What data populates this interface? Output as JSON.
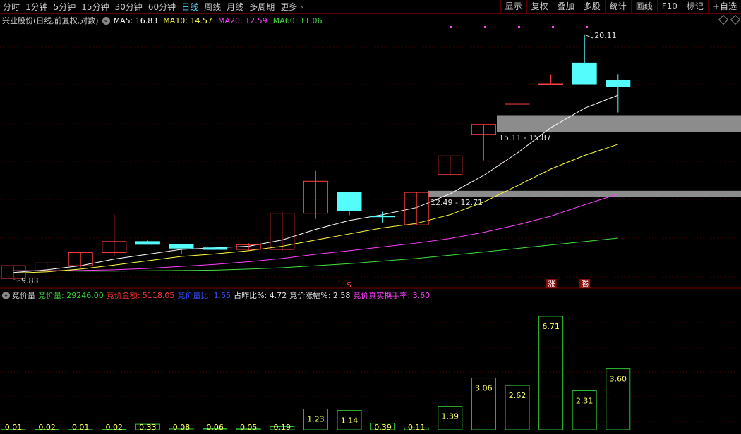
{
  "toolbar": {
    "periods": [
      {
        "label": "分时",
        "active": false
      },
      {
        "label": "1分钟",
        "active": false
      },
      {
        "label": "5分钟",
        "active": false
      },
      {
        "label": "15分钟",
        "active": false
      },
      {
        "label": "30分钟",
        "active": false
      },
      {
        "label": "60分钟",
        "active": false
      },
      {
        "label": "日线",
        "active": true
      },
      {
        "label": "周线",
        "active": false
      },
      {
        "label": "月线",
        "active": false
      },
      {
        "label": "多周期",
        "active": false
      },
      {
        "label": "更多",
        "active": false
      }
    ],
    "tools": [
      "显示",
      "复权",
      "叠加",
      "多股",
      "统计",
      "画线",
      "F10",
      "标记",
      "+自选"
    ]
  },
  "info": {
    "stock_title": "兴业股份(日线,前复权,对数)",
    "ma": [
      {
        "label": "MA5: 16.83",
        "color": "#ffffff"
      },
      {
        "label": "MA10: 14.57",
        "color": "#ffff40"
      },
      {
        "label": "MA20: 12.59",
        "color": "#ff40ff"
      },
      {
        "label": "MA60: 11.06",
        "color": "#40e040"
      }
    ]
  },
  "colors": {
    "up": "#ff4040",
    "down": "#54fcfc",
    "volume": "#30c030",
    "grid": "#5a0000"
  },
  "price_chart": {
    "type": "candlestick",
    "scale": "log",
    "high_label": "20.11",
    "low_label": "9.83",
    "zones": [
      {
        "label": "15.11 - 15.87",
        "low": 15.11,
        "high": 15.87
      },
      {
        "label": "12.49 - 12.71",
        "low": 12.49,
        "high": 12.71
      }
    ],
    "candles": [
      {
        "o": 9.83,
        "c": 10.2,
        "h": 10.2,
        "l": 9.83
      },
      {
        "o": 10.05,
        "c": 10.28,
        "h": 10.3,
        "l": 10.0
      },
      {
        "o": 10.2,
        "c": 10.6,
        "h": 10.62,
        "l": 10.15
      },
      {
        "o": 10.6,
        "c": 10.95,
        "h": 11.85,
        "l": 10.5
      },
      {
        "o": 10.95,
        "c": 10.86,
        "h": 10.98,
        "l": 10.85
      },
      {
        "o": 10.86,
        "c": 10.74,
        "h": 10.87,
        "l": 10.56
      },
      {
        "o": 10.75,
        "c": 10.7,
        "h": 10.76,
        "l": 10.69
      },
      {
        "o": 10.7,
        "c": 10.85,
        "h": 10.9,
        "l": 10.66
      },
      {
        "o": 10.7,
        "c": 11.9,
        "h": 11.95,
        "l": 10.66
      },
      {
        "o": 11.9,
        "c": 13.07,
        "h": 13.5,
        "l": 11.7
      },
      {
        "o": 12.65,
        "c": 12.0,
        "h": 12.65,
        "l": 11.83
      },
      {
        "o": 11.8,
        "c": 11.78,
        "h": 11.95,
        "l": 11.58
      },
      {
        "o": 11.5,
        "c": 12.65,
        "h": 12.65,
        "l": 11.48
      },
      {
        "o": 13.33,
        "c": 14.08,
        "h": 14.08,
        "l": 13.33
      },
      {
        "o": 15.0,
        "c": 15.44,
        "h": 15.44,
        "l": 13.9
      },
      {
        "o": 16.4,
        "c": 16.42,
        "h": 16.42,
        "l": 16.4
      },
      {
        "o": 17.4,
        "c": 17.4,
        "h": 17.9,
        "l": 17.4
      },
      {
        "o": 18.5,
        "c": 17.4,
        "h": 20.11,
        "l": 17.4
      },
      {
        "o": 17.6,
        "c": 17.25,
        "h": 17.9,
        "l": 16.0
      }
    ],
    "ma5": [
      10.0,
      10.08,
      10.2,
      10.4,
      10.55,
      10.7,
      10.75,
      10.8,
      11.0,
      11.35,
      11.65,
      11.85,
      12.1,
      12.6,
      13.3,
      14.2,
      15.3,
      16.2,
      16.83
    ],
    "ma10": [
      9.98,
      10.02,
      10.1,
      10.22,
      10.35,
      10.48,
      10.56,
      10.66,
      10.8,
      11.0,
      11.2,
      11.4,
      11.55,
      11.85,
      12.3,
      12.9,
      13.55,
      14.1,
      14.57
    ],
    "ma20": [
      10.05,
      10.05,
      10.06,
      10.08,
      10.12,
      10.18,
      10.24,
      10.32,
      10.42,
      10.55,
      10.66,
      10.78,
      10.9,
      11.05,
      11.25,
      11.5,
      11.8,
      12.2,
      12.59
    ],
    "ma60": [
      10.05,
      10.05,
      10.04,
      10.04,
      10.05,
      10.06,
      10.07,
      10.1,
      10.14,
      10.2,
      10.26,
      10.34,
      10.42,
      10.52,
      10.62,
      10.73,
      10.84,
      10.95,
      11.06
    ],
    "markers": [
      {
        "index": 10,
        "text": "S"
      }
    ],
    "badges": [
      {
        "index": 16,
        "text": "涨",
        "bg": "#8a1010"
      },
      {
        "index": 17,
        "text": "腾",
        "bg": "#8a1010"
      }
    ]
  },
  "auction": {
    "title": "竞价量",
    "items": [
      {
        "label": "竞价量: 29246.00",
        "color": "#30d030"
      },
      {
        "label": "竞价金额: 5118.05",
        "color": "#ff3030"
      },
      {
        "label": "竞价量比: 1.55",
        "color": "#3050ff"
      },
      {
        "label": "占昨比%: 4.72",
        "color": "#e0e0e0"
      },
      {
        "label": "竞价涨幅%: 2.58",
        "color": "#e0e0e0"
      },
      {
        "label": "竞价真实换手率: 3.60",
        "color": "#ff40ff"
      }
    ],
    "chart_data": {
      "type": "bar",
      "values": [
        0.01,
        0.02,
        0.01,
        0.02,
        0.33,
        0.08,
        0.06,
        0.05,
        0.19,
        1.23,
        1.14,
        0.39,
        0.11,
        1.39,
        3.06,
        2.62,
        6.71,
        2.31,
        3.6
      ],
      "labels": [
        "0.01",
        "0.02",
        "0.01",
        "0.02",
        "0.33",
        "0.08",
        "0.06",
        "0.05",
        "0.19",
        "1.23",
        "1.14",
        "0.39",
        "0.11",
        "1.39",
        "3.06",
        "2.62",
        "6.71",
        "2.31",
        "3.60"
      ],
      "ylim": [
        0,
        7.5
      ]
    }
  }
}
